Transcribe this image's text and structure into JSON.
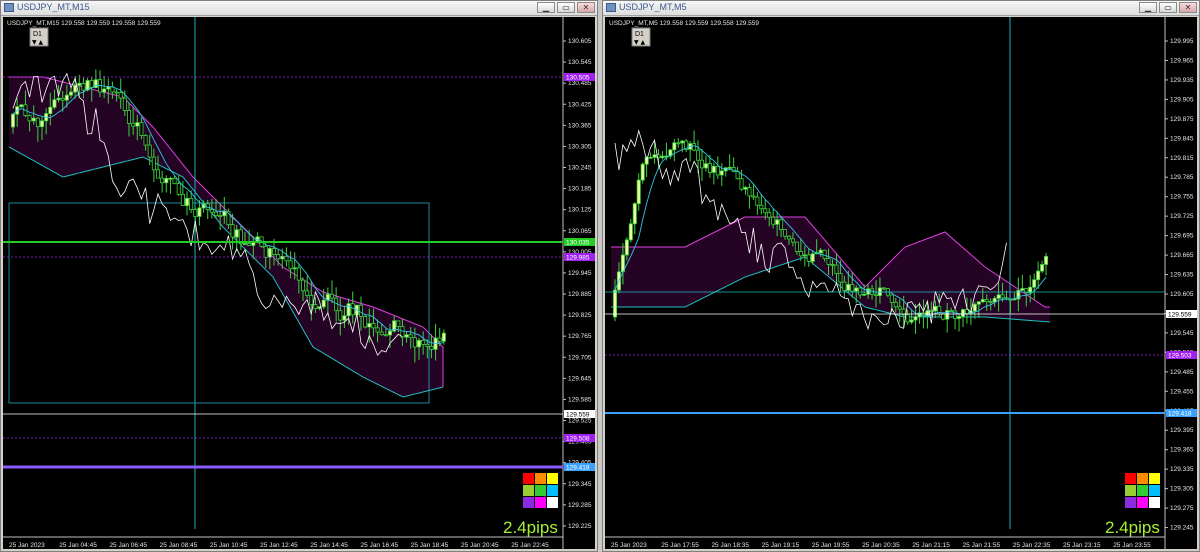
{
  "windows": [
    {
      "title": "USDJPY_MT,M15",
      "info": "USDJPY_MT,M15  129.558 129.559 129.558 129.559",
      "period_button": "D1",
      "y_ticks": [
        "130.605",
        "130.545",
        "130.485",
        "130.425",
        "130.365",
        "130.305",
        "130.245",
        "130.185",
        "130.125",
        "130.065",
        "130.005",
        "129.945",
        "129.885",
        "129.825",
        "129.765",
        "129.705",
        "129.645",
        "129.585",
        "129.525",
        "129.465",
        "129.405",
        "129.345",
        "129.285",
        "129.225"
      ],
      "x_ticks": [
        "25 Jan 2023",
        "25 Jan 04:45",
        "25 Jan 06:45",
        "25 Jan 08:45",
        "25 Jan 10:45",
        "25 Jan 12:45",
        "25 Jan 14:45",
        "25 Jan 16:45",
        "25 Jan 18:45",
        "25 Jan 20:45",
        "25 Jan 22:45"
      ],
      "price_tags": [
        {
          "text": "130.505",
          "color": "#a020f0"
        },
        {
          "text": "130.035",
          "color": "#22cc22"
        },
        {
          "text": "129.985",
          "color": "#a020f0"
        },
        {
          "text": "129.559",
          "color": "#ffffff"
        },
        {
          "text": "129.508",
          "color": "#a020f0"
        },
        {
          "text": "129.418",
          "color": "#3aa0ff"
        }
      ],
      "pips": "2.4pips"
    },
    {
      "title": "USDJPY_MT,M5",
      "info": "USDJPY_MT,M5  129.558 129.559 129.558 129.559",
      "period_button": "D1",
      "y_ticks": [
        "129.995",
        "129.965",
        "129.935",
        "129.905",
        "129.875",
        "129.845",
        "129.815",
        "129.785",
        "129.755",
        "129.725",
        "129.695",
        "129.665",
        "129.635",
        "129.605",
        "129.575",
        "129.545",
        "129.515",
        "129.485",
        "129.455",
        "129.425",
        "129.395",
        "129.365",
        "129.335",
        "129.305",
        "129.275",
        "129.245"
      ],
      "x_ticks": [
        "25 Jan 2023",
        "25 Jan 17:55",
        "25 Jan 18:35",
        "25 Jan 19:15",
        "25 Jan 19:55",
        "25 Jan 20:35",
        "25 Jan 21:15",
        "25 Jan 21:55",
        "25 Jan 22:35",
        "25 Jan 23:15",
        "25 Jan 23:55"
      ],
      "price_tags": [
        {
          "text": "129.559",
          "color": "#ffffff"
        },
        {
          "text": "129.503",
          "color": "#a020f0"
        },
        {
          "text": "129.418",
          "color": "#3aa0ff"
        }
      ],
      "pips": "2.4pips"
    }
  ],
  "color_grid": [
    "#ff0000",
    "#ff8c00",
    "#ffff00",
    "#9acd32",
    "#32cd32",
    "#00bfff",
    "#8a2be2",
    "#ff00ff",
    "#ffffff"
  ],
  "icons": {
    "minimize": "minimize-icon",
    "maximize": "maximize-icon",
    "close": "close-icon",
    "dropdown": "triangle-down-icon"
  }
}
